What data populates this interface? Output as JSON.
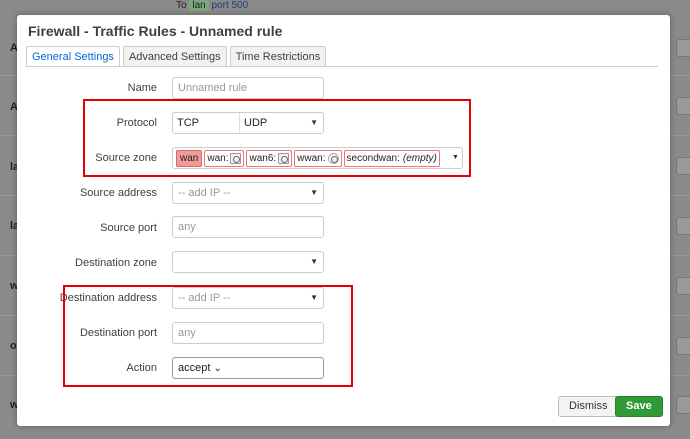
{
  "background": {
    "top_text": "To",
    "top_zone": "lan",
    "top_port": "port 500",
    "row_letters": [
      "A",
      "A",
      "la",
      "la",
      "w",
      "o",
      "w"
    ]
  },
  "modal": {
    "title": "Firewall - Traffic Rules - Unnamed rule",
    "tabs": [
      "General Settings",
      "Advanced Settings",
      "Time Restrictions"
    ],
    "active_tab": "General Settings"
  },
  "form": {
    "name": {
      "label": "Name",
      "placeholder": "Unnamed rule"
    },
    "protocol": {
      "label": "Protocol",
      "values": [
        "TCP",
        "UDP"
      ]
    },
    "source_zone": {
      "label": "Source zone",
      "selected": "wan",
      "options": [
        {
          "name": "wan:",
          "icon": "network-icon"
        },
        {
          "name": "wan6:",
          "icon": "network-icon"
        },
        {
          "name": "wwan:",
          "icon": "wifi-icon"
        },
        {
          "name": "secondwan:",
          "note": "(empty)"
        }
      ]
    },
    "source_address": {
      "label": "Source address",
      "placeholder": "-- add IP --"
    },
    "source_port": {
      "label": "Source port",
      "placeholder": "any"
    },
    "destination_zone": {
      "label": "Destination zone",
      "value": ""
    },
    "destination_address": {
      "label": "Destination address",
      "placeholder": "-- add IP --"
    },
    "destination_port": {
      "label": "Destination port",
      "placeholder": "any"
    },
    "action": {
      "label": "Action",
      "value": "accept"
    }
  },
  "buttons": {
    "dismiss": "Dismiss",
    "save": "Save"
  },
  "colors": {
    "highlight": "#e00000",
    "save": "#2f9a36",
    "tab_active": "#0069d6",
    "zone_wan": "#f09a9a"
  }
}
